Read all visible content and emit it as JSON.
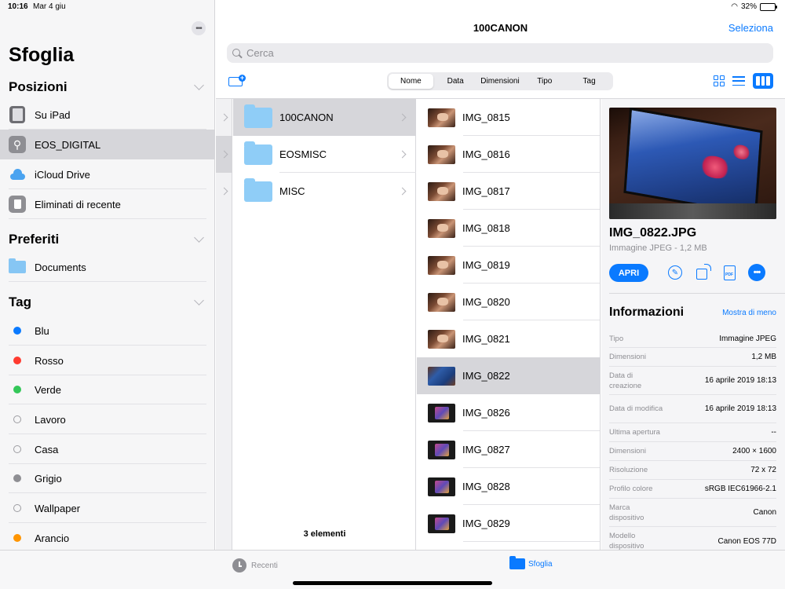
{
  "status": {
    "time": "10:16",
    "date": "Mar 4 giu",
    "battery": "32%",
    "battery_level": 0.32
  },
  "sidebar": {
    "title": "Sfoglia",
    "sections": {
      "posizioni": "Posizioni",
      "preferiti": "Preferiti",
      "tag": "Tag"
    },
    "locations": [
      {
        "label": "Su iPad",
        "icon": "ipad-icon"
      },
      {
        "label": "EOS_DIGITAL",
        "icon": "usb-drive-icon"
      },
      {
        "label": "iCloud Drive",
        "icon": "icloud-icon"
      },
      {
        "label": "Eliminati di recente",
        "icon": "trash-icon"
      }
    ],
    "favorites": [
      {
        "label": "Documents",
        "icon": "folder-icon"
      }
    ],
    "tags": [
      {
        "label": "Blu",
        "color": "#0a7aff"
      },
      {
        "label": "Rosso",
        "color": "#ff3b30"
      },
      {
        "label": "Verde",
        "color": "#34c759"
      },
      {
        "label": "Lavoro",
        "color": ""
      },
      {
        "label": "Casa",
        "color": ""
      },
      {
        "label": "Grigio",
        "color": "#8e8e93"
      },
      {
        "label": "Wallpaper",
        "color": ""
      },
      {
        "label": "Arancio",
        "color": "#ff9500"
      }
    ]
  },
  "header": {
    "title": "100CANON",
    "select_label": "Seleziona",
    "search_placeholder": "Cerca",
    "sort_options": [
      "Nome",
      "Data",
      "Dimensioni",
      "Tipo",
      "Tag"
    ],
    "sort_selected": "Nome"
  },
  "folders": {
    "items": [
      "100CANON",
      "EOSMISC",
      "MISC"
    ],
    "count_label": "3 elementi"
  },
  "files": [
    {
      "name": "IMG_0815",
      "thumb": "hand"
    },
    {
      "name": "IMG_0816",
      "thumb": "hand"
    },
    {
      "name": "IMG_0817",
      "thumb": "hand"
    },
    {
      "name": "IMG_0818",
      "thumb": "hand"
    },
    {
      "name": "IMG_0819",
      "thumb": "hand"
    },
    {
      "name": "IMG_0820",
      "thumb": "hand"
    },
    {
      "name": "IMG_0821",
      "thumb": "hand"
    },
    {
      "name": "IMG_0822",
      "thumb": "screen"
    },
    {
      "name": "IMG_0826",
      "thumb": "dark"
    },
    {
      "name": "IMG_0827",
      "thumb": "dark"
    },
    {
      "name": "IMG_0828",
      "thumb": "dark"
    },
    {
      "name": "IMG_0829",
      "thumb": "dark"
    }
  ],
  "preview": {
    "filename": "IMG_0822.JPG",
    "subtitle": "Immagine JPEG - 1,2 MB",
    "open_label": "APRI",
    "info_title": "Informazioni",
    "info_toggle": "Mostra di meno",
    "info": [
      {
        "key": "Tipo",
        "value": "Immagine JPEG"
      },
      {
        "key": "Dimensioni",
        "value": "1,2 MB"
      },
      {
        "key": "Data di creazione",
        "value": "16 aprile 2019 18:13"
      },
      {
        "key": "Data di modifica",
        "value": "16 aprile 2019 18:13"
      },
      {
        "key": "Ultima apertura",
        "value": "--"
      },
      {
        "key": "Dimensioni",
        "value": "2400 × 1600"
      },
      {
        "key": "Risoluzione",
        "value": "72 x 72"
      },
      {
        "key": "Profilo colore",
        "value": "sRGB IEC61966-2.1"
      },
      {
        "key": "Marca dispositivo",
        "value": "Canon"
      },
      {
        "key": "Modello dispositivo",
        "value": "Canon EOS 77D"
      }
    ]
  },
  "tabbar": {
    "recent": "Recenti",
    "browse": "Sfoglia"
  },
  "colors": {
    "accent": "#0a7aff",
    "selection": "#d6d6da"
  }
}
